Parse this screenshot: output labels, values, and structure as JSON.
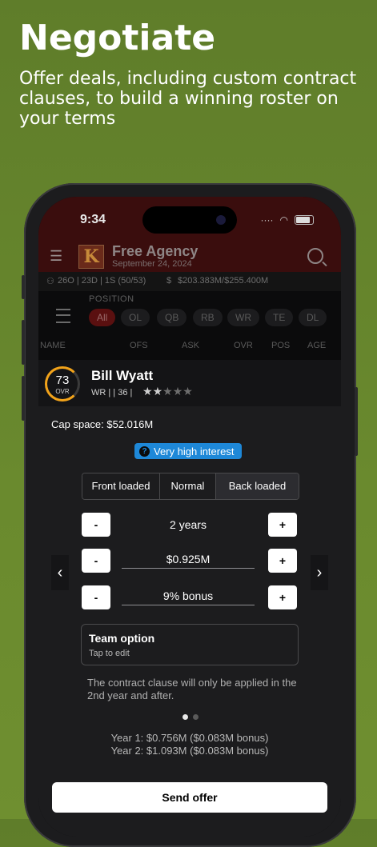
{
  "promo": {
    "title": "Negotiate",
    "subtitle": "Offer deals, including custom contract clauses, to build a winning roster on your terms"
  },
  "status_bar": {
    "time": "9:34"
  },
  "header": {
    "logo_letter": "K",
    "title": "Free Agency",
    "date": "September 24, 2024"
  },
  "info_bar": {
    "roster": "26O | 23D | 1S (50/53)",
    "cap": "$203.383M/$255.400M"
  },
  "filters": {
    "label": "POSITION",
    "positions": [
      "All",
      "OL",
      "QB",
      "RB",
      "WR",
      "TE",
      "DL"
    ]
  },
  "columns": [
    "NAME",
    "OFS",
    "ASK",
    "OVR",
    "POS",
    "AGE"
  ],
  "player": {
    "ovr": "73",
    "ovr_label": "OVR",
    "name": "Bill Wyatt",
    "meta": "WR |  | 36 |",
    "stars": 2.5
  },
  "offer": {
    "cap_space": "Cap space: $52.016M",
    "interest": "Very high interest",
    "structure_options": [
      "Front loaded",
      "Normal",
      "Back loaded"
    ],
    "selected_structure": "Back loaded",
    "years": "2 years",
    "amount": "$0.925M",
    "bonus": "9% bonus",
    "minus": "-",
    "plus": "+",
    "clause_title": "Team option",
    "clause_sub": "Tap to edit",
    "clause_note": "The contract clause will only be applied in the 2nd year and after.",
    "year1": "Year 1: $0.756M ($0.083M bonus)",
    "year2": "Year 2: $1.093M ($0.083M bonus)",
    "send_label": "Send offer",
    "page_count": 2,
    "page_index": 0
  }
}
